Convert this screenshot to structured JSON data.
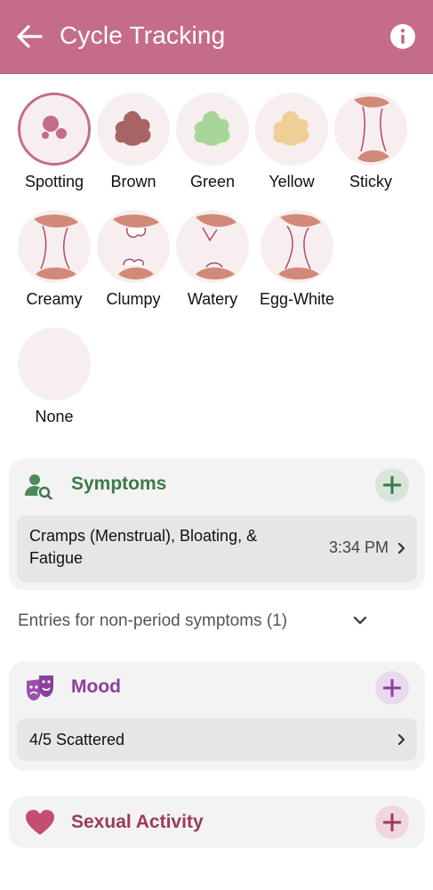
{
  "header": {
    "title": "Cycle Tracking",
    "back_icon": "arrow-left-icon",
    "info_icon": "info-icon"
  },
  "colors": {
    "header": "#c46c8a",
    "symptoms": "#3a7a4c",
    "mood": "#8a3f9c",
    "sexual_activity": "#9c3a56",
    "tissue": "#d18a78"
  },
  "discharge_options": [
    {
      "label": "Spotting",
      "selected": true
    },
    {
      "label": "Brown",
      "selected": false
    },
    {
      "label": "Green",
      "selected": false
    },
    {
      "label": "Yellow",
      "selected": false
    },
    {
      "label": "Sticky",
      "selected": false
    },
    {
      "label": "Creamy",
      "selected": false
    },
    {
      "label": "Clumpy",
      "selected": false
    },
    {
      "label": "Watery",
      "selected": false
    },
    {
      "label": "Egg-White",
      "selected": false
    },
    {
      "label": "None",
      "selected": false
    }
  ],
  "symptoms": {
    "title": "Symptoms",
    "icon": "person-search-icon",
    "entry_line1": "Cramps (Menstrual), Bloating, &",
    "entry_line2": "Fatigue",
    "entry_time": "3:34 PM"
  },
  "non_period": {
    "label": "Entries for non-period symptoms (1)"
  },
  "mood": {
    "title": "Mood",
    "icon": "theater-masks-icon",
    "entry": "4/5 Scattered"
  },
  "sexual_activity": {
    "title": "Sexual Activity",
    "icon": "heart-icon"
  }
}
